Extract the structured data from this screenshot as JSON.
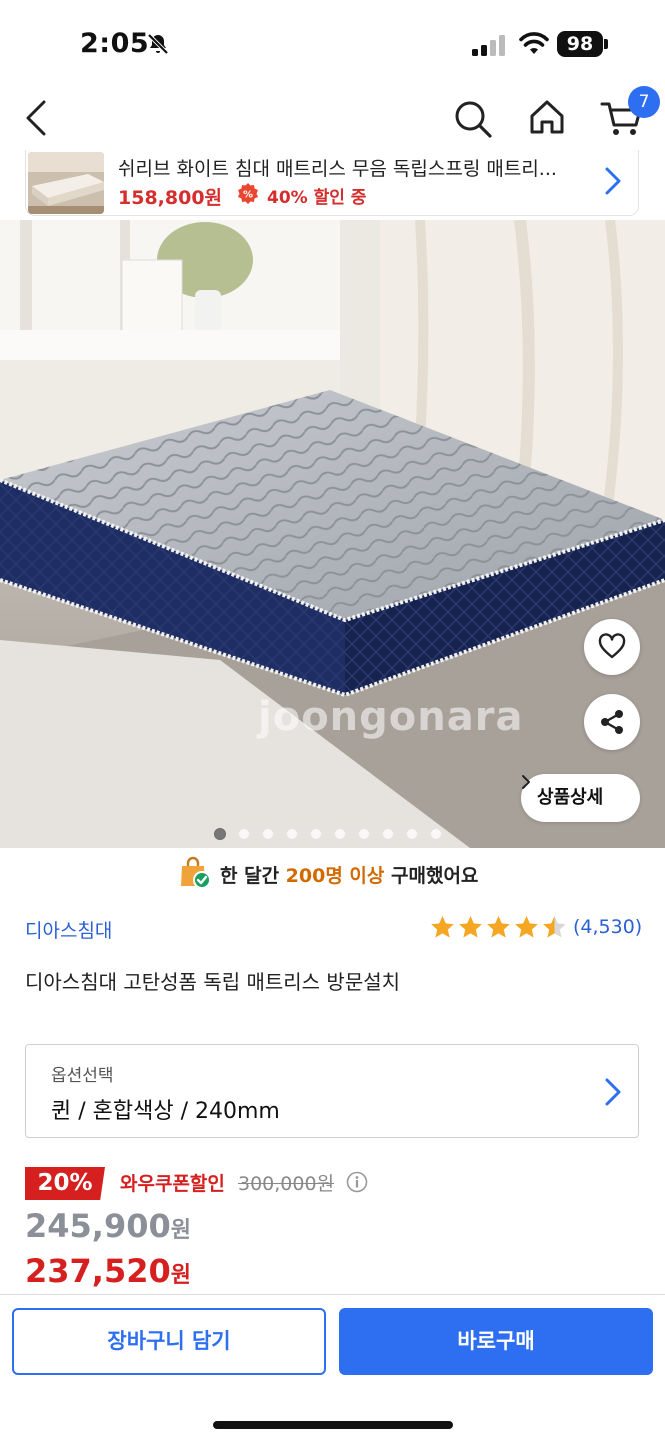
{
  "status_bar": {
    "time": "2:05",
    "battery": "98"
  },
  "nav": {
    "cart_count": "7"
  },
  "mini_bar": {
    "title": "쉬리브 화이트 침대 매트리스 무음 독립스프링 매트리...",
    "price": "158,800원",
    "discount_icon": "%",
    "discount_text": "40% 할인 중"
  },
  "hero": {
    "watermark": "joongonara",
    "detail_button": "상품상세",
    "slide_count": 10,
    "active_slide": 1
  },
  "social_proof": {
    "prefix": "한 달간 ",
    "highlight": "200명 이상",
    "suffix": " 구매했어요"
  },
  "product": {
    "brand": "디아스침대",
    "rating": 4.5,
    "review_count": "(4,530)",
    "title": "디아스침대 고탄성폼 독립 매트리스 방문설치"
  },
  "option": {
    "label": "옵션선택",
    "value": "퀸 / 혼합색상 / 240mm"
  },
  "pricing": {
    "discount_badge": "20%",
    "coupon_label": "와우쿠폰할인",
    "original_price": "300,000원",
    "price_number": "245,900",
    "price_unit": "원",
    "final_price_number": "237,520",
    "final_price_unit": "원"
  },
  "actions": {
    "cart_label": "장바구니 담기",
    "buy_label": "바로구매"
  },
  "colors": {
    "accent": "#2e6ff2",
    "sale_red": "#d62020",
    "brand_blue": "#2a5fd6",
    "star": "#f5a623",
    "highlight_orange": "#d26a00"
  },
  "icons": {
    "status": [
      "bell-slash-icon",
      "signal-icon",
      "wifi-icon",
      "battery-icon"
    ],
    "nav": [
      "back-chevron-icon",
      "search-icon",
      "home-icon",
      "cart-icon"
    ],
    "hero": [
      "heart-icon",
      "share-icon",
      "chevron-right-icon"
    ],
    "proof": "shopping-bag-check-icon",
    "pricing": "info-icon"
  }
}
